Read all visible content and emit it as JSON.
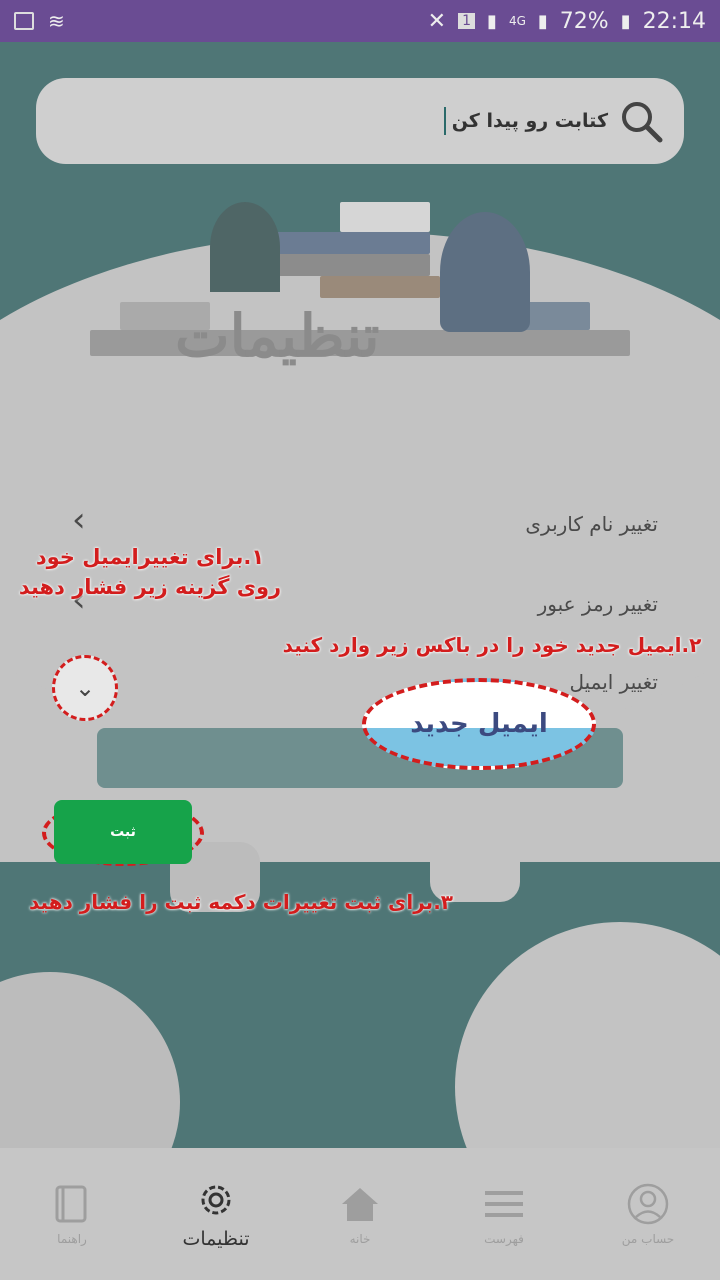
{
  "status_bar": {
    "battery": "72%",
    "time": "22:14",
    "sim": "1",
    "network": "4G"
  },
  "search": {
    "placeholder": "کتابت رو پیدا کن"
  },
  "header": {
    "title": "تنظیمات"
  },
  "settings": [
    {
      "label": "تغییر نام کاربری"
    },
    {
      "label": "تغییر رمز عبور"
    },
    {
      "label": "تغییر ایمیل"
    }
  ],
  "email_field": {
    "placeholder": "ایمیل جدید"
  },
  "submit_button": {
    "label": "ثبت"
  },
  "instructions": {
    "step1": "۱.برای تغییرایمیل خود روی گزینه زیر فشار دهید",
    "step2": "۲.ایمیل جدید خود را در باکس زیر وارد کنید",
    "step3": "۳.برای ثبت تغییرات دکمه ثبت را فشار دهید"
  },
  "tabs": [
    {
      "label": "حساب من",
      "icon": "user-icon"
    },
    {
      "label": "فهرست",
      "icon": "list-icon"
    },
    {
      "label": "خانه",
      "icon": "home-icon"
    },
    {
      "label": "تنظیمات",
      "icon": "gear-icon",
      "active": true
    },
    {
      "label": "راهنما",
      "icon": "book-icon"
    }
  ],
  "colors": {
    "status_bar": "#6a4c93",
    "teal": "#4f7676",
    "accent_red": "#d31d1d",
    "submit_green": "#16a34a"
  }
}
